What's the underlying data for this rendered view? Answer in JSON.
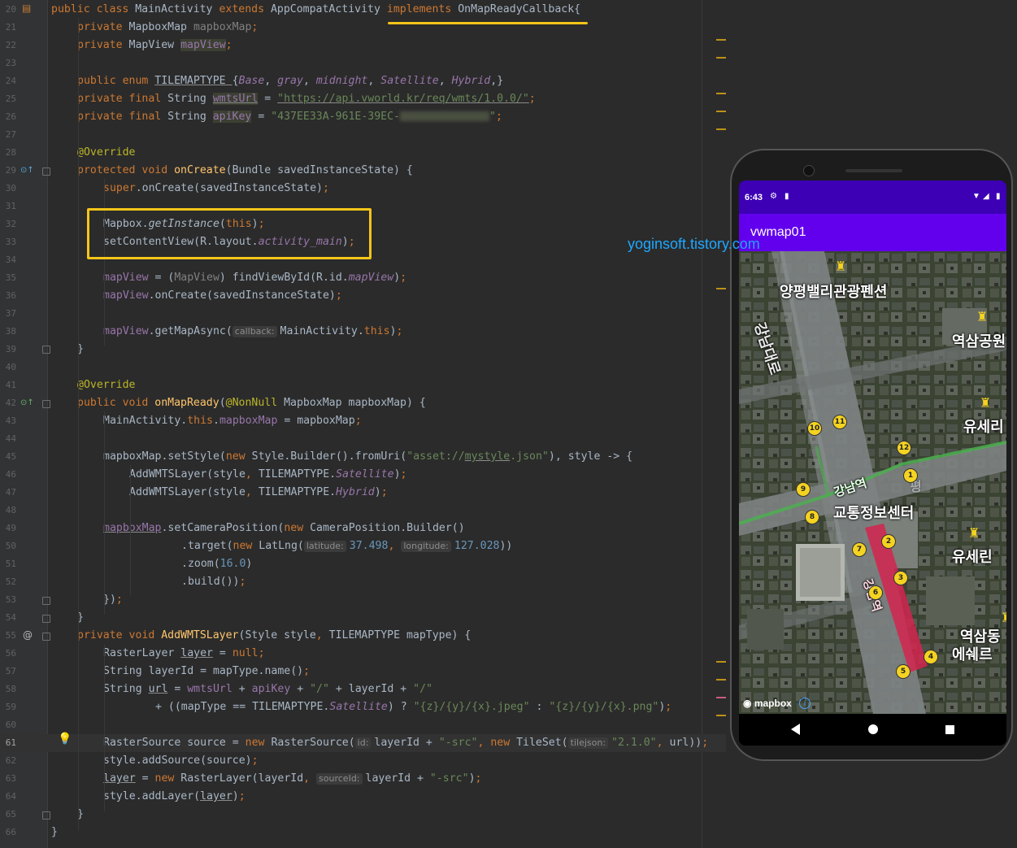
{
  "editor": {
    "current_line": 61,
    "lines": [
      {
        "n": 20
      },
      {
        "n": 21
      },
      {
        "n": 22
      },
      {
        "n": 23
      },
      {
        "n": 24
      },
      {
        "n": 25
      },
      {
        "n": 26
      },
      {
        "n": 27
      },
      {
        "n": 28
      },
      {
        "n": 29
      },
      {
        "n": 30
      },
      {
        "n": 31
      },
      {
        "n": 32
      },
      {
        "n": 33
      },
      {
        "n": 34
      },
      {
        "n": 35
      },
      {
        "n": 36
      },
      {
        "n": 37
      },
      {
        "n": 38
      },
      {
        "n": 39
      },
      {
        "n": 40
      },
      {
        "n": 41
      },
      {
        "n": 42
      },
      {
        "n": 43
      },
      {
        "n": 44
      },
      {
        "n": 45
      },
      {
        "n": 46
      },
      {
        "n": 47
      },
      {
        "n": 48
      },
      {
        "n": 49
      },
      {
        "n": 50
      },
      {
        "n": 51
      },
      {
        "n": 52
      },
      {
        "n": 53
      },
      {
        "n": 54
      },
      {
        "n": 55
      },
      {
        "n": 56
      },
      {
        "n": 57
      },
      {
        "n": 58
      },
      {
        "n": 59
      },
      {
        "n": 60
      },
      {
        "n": 61
      },
      {
        "n": 62
      },
      {
        "n": 63
      },
      {
        "n": 64
      },
      {
        "n": 65
      },
      {
        "n": 66
      }
    ],
    "code": {
      "l20": [
        "public class ",
        "MainActivity ",
        "extends ",
        "AppCompatActivity ",
        "implements ",
        "OnMapReadyCallback{"
      ],
      "l21": [
        "private ",
        "MapboxMap ",
        "mapboxMap",
        ";"
      ],
      "l22": [
        "private ",
        "MapView ",
        "mapView",
        ";"
      ],
      "l24": [
        "public enum ",
        "TILEMAPTYPE ",
        "{",
        "Base",
        ", ",
        "gray",
        ", ",
        "midnight",
        ", ",
        "Satellite",
        ", ",
        "Hybrid",
        ",}"
      ],
      "l25": [
        "private final ",
        "String ",
        "wmtsUrl",
        " = ",
        "\"https://api.vworld.kr/req/wmts/1.0.0/\"",
        ";"
      ],
      "l26": [
        "private final ",
        "String ",
        "apiKey",
        " = ",
        "\"437EE33A-961E-39EC-",
        "\"",
        ";"
      ],
      "l28": [
        "@Override"
      ],
      "l29": [
        "protected void ",
        "onCreate",
        "(Bundle savedInstanceState) {"
      ],
      "l30": [
        "super",
        ".onCreate(savedInstanceState)",
        ";"
      ],
      "l32": [
        "Mapbox.",
        "getInstance",
        "(",
        "this",
        ")",
        ";"
      ],
      "l33": [
        "setContentView(R.layout.",
        "activity_main",
        ")",
        ";"
      ],
      "l35": [
        "mapView",
        " = (",
        "MapView",
        ") findViewById(R.id.",
        "mapView",
        ")",
        ";"
      ],
      "l36": [
        "mapView",
        ".onCreate(savedInstanceState)",
        ";"
      ],
      "l38": [
        "mapView",
        ".getMapAsync(",
        "callback:",
        "MainActivity.",
        "this",
        ")",
        ";"
      ],
      "l39": [
        "}"
      ],
      "l41": [
        "@Override"
      ],
      "l42": [
        "public void ",
        "onMapReady",
        "(",
        "@NonNull ",
        "MapboxMap mapboxMap) {"
      ],
      "l43": [
        "MainActivity.",
        "this",
        ".",
        "mapboxMap",
        " = mapboxMap",
        ";"
      ],
      "l45": [
        "mapboxMap.setStyle(",
        "new ",
        "Style.Builder().fromUri(",
        "\"asset://",
        "mystyle",
        ".json\"",
        ")",
        ", style -> {"
      ],
      "l46": [
        "AddWMTSLayer(style",
        ", ",
        "TILEMAPTYPE.",
        "Satellite",
        ")",
        ";"
      ],
      "l47": [
        "AddWMTSLayer(style",
        ", ",
        "TILEMAPTYPE.",
        "Hybrid",
        ")",
        ";"
      ],
      "l49": [
        "mapboxMap",
        ".setCameraPosition(",
        "new ",
        "CameraPosition.Builder()"
      ],
      "l50": [
        ".target(",
        "new ",
        "LatLng(",
        "latitude:",
        "37.498",
        ", ",
        "longitude:",
        "127.028",
        "))"
      ],
      "l51": [
        ".zoom(",
        "16.0",
        ")"
      ],
      "l52": [
        ".build())",
        ";"
      ],
      "l53": [
        "})",
        ";"
      ],
      "l54": [
        "}"
      ],
      "l55": [
        "private void ",
        "AddWMTSLayer",
        "(Style style",
        ", ",
        "TILEMAPTYPE mapType) {"
      ],
      "l56": [
        "RasterLayer ",
        "layer",
        " = ",
        "null",
        ";"
      ],
      "l57": [
        "String layerId = mapType.name()",
        ";"
      ],
      "l58": [
        "String ",
        "url",
        " = ",
        "wmtsUrl",
        " + ",
        "apiKey",
        " + ",
        "\"/\"",
        " + layerId + ",
        "\"/\""
      ],
      "l59": [
        "+ ((mapType == TILEMAPTYPE.",
        "Satellite",
        ") ? ",
        "\"{z}/{y}/{x}.jpeg\"",
        " : ",
        "\"{z}/{y}/{x}.png\"",
        ")",
        ";"
      ],
      "l61": [
        "RasterSource source = ",
        "new ",
        "RasterSource(",
        "id:",
        "layerId + ",
        "\"-src\"",
        ", ",
        "new ",
        "TileSet(",
        "tilejson:",
        "\"2.1.0\"",
        ", ",
        "url",
        "))",
        ";"
      ],
      "l62": [
        "style.addSource(source)",
        ";"
      ],
      "l63": [
        "layer",
        " = ",
        "new ",
        "RasterLayer(layerId",
        ", ",
        "sourceId:",
        "layerId + ",
        "\"-src\"",
        ")",
        ";"
      ],
      "l64": [
        "style.addLayer(",
        "layer",
        ")",
        ";"
      ],
      "l65": [
        "}"
      ],
      "l66": [
        "}"
      ]
    }
  },
  "watermark": "yoginsoft.tistory.com",
  "phone": {
    "time": "6:43",
    "app_title": "vwmap01",
    "map_labels": {
      "pension": "양평밸리관광펜션",
      "road": "강남대로",
      "station_top": "역삼공원",
      "yuseria": "유세리",
      "gangnam": "강남역",
      "traffic": "교통정보센터",
      "yuseria2": "유세린",
      "gangnam_red": "강남역",
      "station_bottom": "역삼동",
      "eshere": "에쉐르",
      "faint": "평"
    },
    "exits": [
      "1",
      "2",
      "3",
      "4",
      "5",
      "6",
      "7",
      "8",
      "9",
      "10",
      "11",
      "12"
    ],
    "attribution": "mapbox",
    "colors": {
      "statusbar": "#3d00b5",
      "appbar": "#6200ee",
      "line2": "#4caf50",
      "sinbundang": "#d4244f",
      "exit": "#f4d321"
    }
  }
}
